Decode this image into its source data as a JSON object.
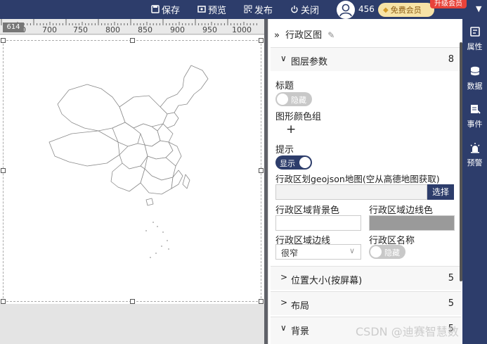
{
  "topbar": {
    "save": "保存",
    "preview": "预览",
    "publish": "发布",
    "close": "关闭",
    "user_id": "456",
    "member_badge": "免费会员",
    "upgrade": "升级会员"
  },
  "ruler": {
    "corner": "614",
    "ticks": [
      "650",
      "700",
      "750",
      "800",
      "850",
      "900",
      "950",
      "1000"
    ]
  },
  "panel": {
    "title": "行政区图",
    "sections": [
      {
        "label": "图层参数",
        "count": "8",
        "expanded": true
      },
      {
        "label": "位置大小(按屏幕)",
        "count": "5",
        "expanded": false
      },
      {
        "label": "布局",
        "count": "5",
        "expanded": false
      },
      {
        "label": "背景",
        "count": "5",
        "expanded": true
      }
    ],
    "fields": {
      "title_label": "标题",
      "title_toggle": "隐藏",
      "color_group_label": "图形颜色组",
      "add_symbol": "+",
      "tooltip_label": "提示",
      "tooltip_toggle": "显示",
      "geojson_label": "行政区划geojson地图(空从高德地图获取)",
      "geojson_value": "",
      "select_button": "选择",
      "area_bg_label": "行政区域背景色",
      "area_border_color_label": "行政区域边线色",
      "area_border_label": "行政区域边线",
      "area_border_value": "很窄",
      "area_name_label": "行政区名称",
      "area_name_toggle": "隐藏"
    }
  },
  "rightbar": {
    "items": [
      "属性",
      "数据",
      "事件",
      "预警"
    ]
  },
  "watermark": "CSDN @迪赛智慧数",
  "colors": {
    "topbar": "#2d3d6b",
    "toggle_on": "#2d3d6b",
    "toggle_off": "#c8c8c8",
    "border_color_swatch": "#9a9a9a"
  }
}
